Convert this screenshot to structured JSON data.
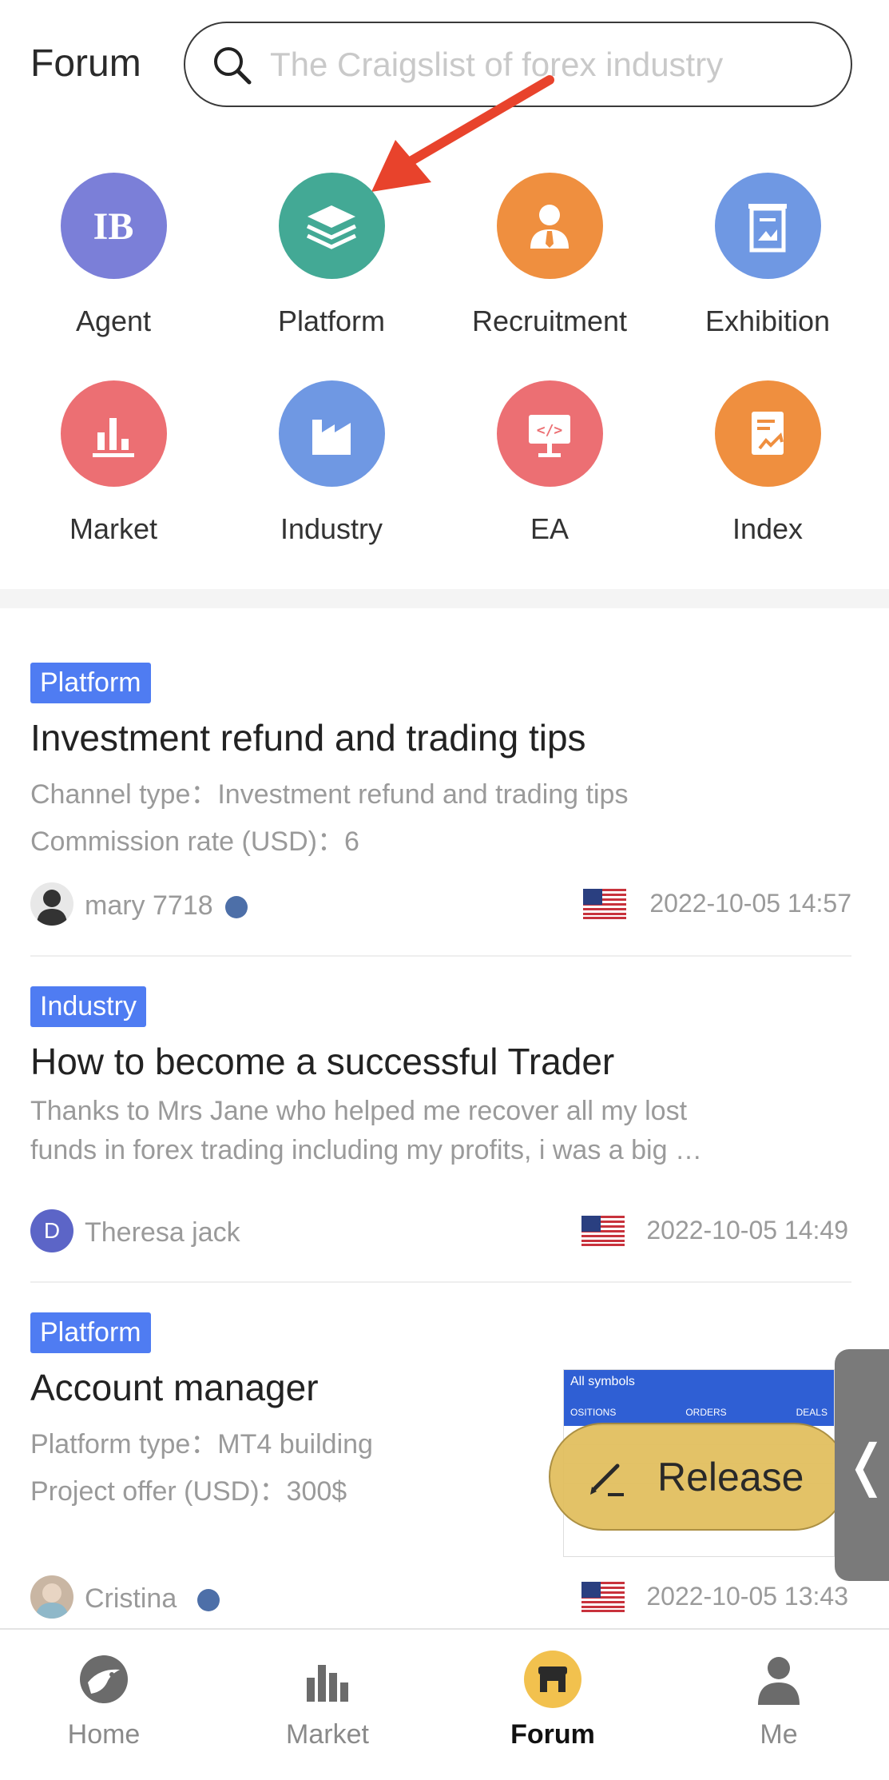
{
  "header": {
    "title": "Forum",
    "search_placeholder": "The Craigslist of forex industry"
  },
  "categories": [
    {
      "label": "Agent",
      "icon": "ib-icon",
      "color": "#7b7fd8"
    },
    {
      "label": "Platform",
      "icon": "layers-icon",
      "color": "#43a995"
    },
    {
      "label": "Recruitment",
      "icon": "person-tie-icon",
      "color": "#ef8f3f"
    },
    {
      "label": "Exhibition",
      "icon": "exhibition-board-icon",
      "color": "#6f98e3"
    },
    {
      "label": "Market",
      "icon": "bar-chart-icon",
      "color": "#ec6f73"
    },
    {
      "label": "Industry",
      "icon": "factory-icon",
      "color": "#6f98e3"
    },
    {
      "label": "EA",
      "icon": "code-monitor-icon",
      "color": "#ec6f73"
    },
    {
      "label": "Index",
      "icon": "document-chart-icon",
      "color": "#ef8f3f"
    }
  ],
  "posts": [
    {
      "tag": "Platform",
      "title": "Investment refund and trading tips",
      "line1": "Channel type：Investment refund and trading tips",
      "line2": "Commission rate (USD)：6",
      "author": "mary 7718",
      "date": "2022-10-05 14:57"
    },
    {
      "tag": "Industry",
      "title": "How to become a successful Trader",
      "line1": "Thanks to Mrs Jane who helped me recover all my lost",
      "line2": "funds in forex trading including my profits, i was a big …",
      "author": "Theresa jack",
      "avatar_letter": "D",
      "date": "2022-10-05 14:49"
    },
    {
      "tag": "Platform",
      "title": "Account manager",
      "line1": "Platform type：MT4 building",
      "line2": "Project offer (USD)：300$",
      "author": "Cristina",
      "date": "2022-10-05 13:43"
    }
  ],
  "thumbnail": {
    "header": "All symbols",
    "cols": [
      "OSITIONS",
      "ORDERS",
      "DEALS"
    ]
  },
  "release_label": "Release",
  "side_tab_glyph": "❬",
  "bottom_nav": [
    {
      "label": "Home",
      "icon": "eagle-logo-icon"
    },
    {
      "label": "Market",
      "icon": "bar-chart-icon"
    },
    {
      "label": "Forum",
      "icon": "store-icon",
      "active": true
    },
    {
      "label": "Me",
      "icon": "user-icon"
    }
  ],
  "colors": {
    "tag_bg": "#4f7cf2",
    "release_bg": "#e2bf5f",
    "annotation_arrow": "#e8432c",
    "forum_active": "#f2c14e"
  }
}
